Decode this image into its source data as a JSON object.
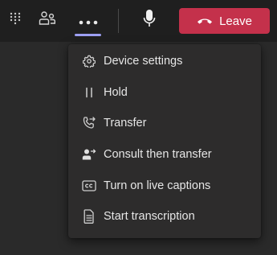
{
  "toolbar": {
    "dialpad_icon": "dialpad-icon",
    "people_icon": "people-icon",
    "more_icon": "more-options-icon",
    "mic_icon": "microphone-icon",
    "leave_label": "Leave",
    "leave_icon": "hang-up-icon",
    "accent_color": "#9d9ff2",
    "leave_color": "#c4314b"
  },
  "menu": {
    "items": [
      {
        "label": "Device settings",
        "icon": "gear-icon"
      },
      {
        "label": "Hold",
        "icon": "pause-icon"
      },
      {
        "label": "Transfer",
        "icon": "call-transfer-icon"
      },
      {
        "label": "Consult then transfer",
        "icon": "person-forward-icon"
      },
      {
        "label": "Turn on live captions",
        "icon": "closed-captions-icon"
      },
      {
        "label": "Start transcription",
        "icon": "transcript-document-icon"
      }
    ]
  }
}
